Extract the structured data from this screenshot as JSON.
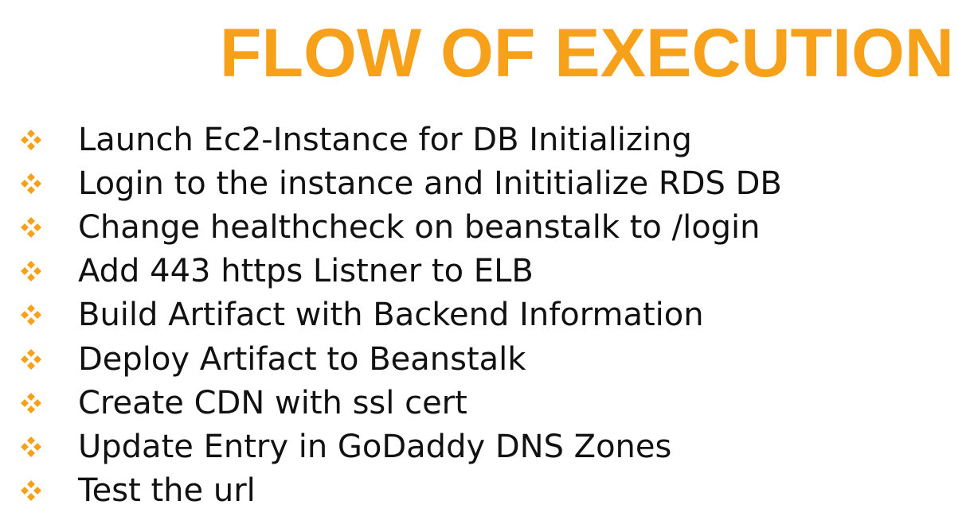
{
  "title": "FLOW OF EXECUTION",
  "bullets": [
    {
      "text": "Launch Ec2-Instance for DB Initializing"
    },
    {
      "text": "Login to the instance and Inititialize RDS DB"
    },
    {
      "text": "Change healthcheck on beanstalk to /login"
    },
    {
      "text": "Add 443 https Listner to ELB"
    },
    {
      "text": "Build Artifact with Backend Information"
    },
    {
      "text": "Deploy Artifact to Beanstalk"
    },
    {
      "text": "Create CDN with ssl cert"
    },
    {
      "text": "Update Entry in GoDaddy DNS Zones"
    },
    {
      "text": "Test the url"
    }
  ],
  "colors": {
    "title": "#f7a11a",
    "bullet_icon": "#f7a11a",
    "text": "#111111",
    "background": "#ffffff"
  },
  "icons": {
    "bullet": "four-diamond-bullet-icon"
  }
}
